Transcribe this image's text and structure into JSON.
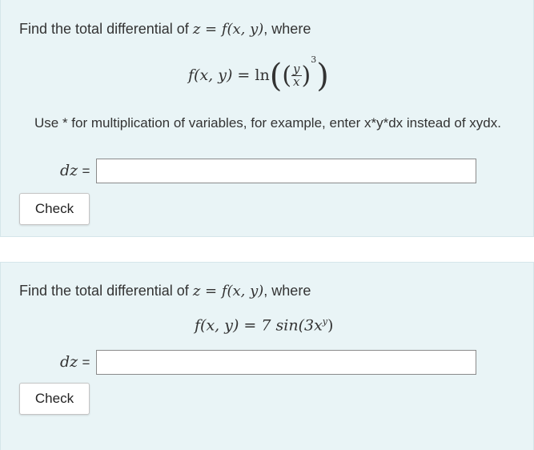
{
  "question1": {
    "prompt_text": "Find the total differential of ",
    "prompt_math": "z = f(x, y)",
    "prompt_suffix": ", where",
    "formula_lhs": "f(x, y) = ",
    "formula_ln": "ln",
    "frac_numerator": "y",
    "frac_denominator": "x",
    "exponent": "3",
    "note": "Use * for multiplication of variables, for example, enter x*y*dx instead of xydx.",
    "answer_label": "dz",
    "answer_eq": "=",
    "answer_value": "",
    "check_label": "Check"
  },
  "question2": {
    "prompt_text": "Find the total differential of ",
    "prompt_math": "z = f(x, y)",
    "prompt_suffix": ", where",
    "formula": "f(x, y) = 7 sin(3x",
    "formula_exponent": "y",
    "formula_close": ")",
    "answer_label": "dz",
    "answer_eq": "=",
    "answer_value": "",
    "check_label": "Check"
  }
}
